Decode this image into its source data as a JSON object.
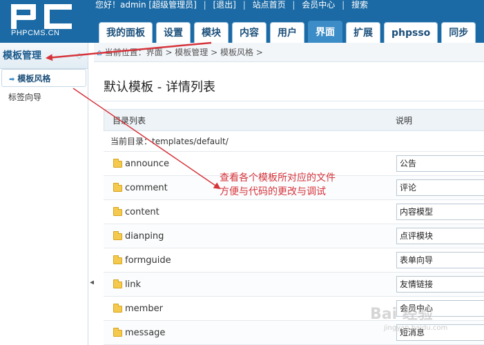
{
  "header": {
    "logo_text": "PHPCMS.CN",
    "topbar": {
      "greeting": "您好！admin [超级管理员]",
      "logout": "[退出]",
      "site_home": "站点首页",
      "member_center": "会员中心",
      "search": "搜索"
    },
    "nav": [
      {
        "label": "我的面板",
        "active": false
      },
      {
        "label": "设置",
        "active": false
      },
      {
        "label": "模块",
        "active": false
      },
      {
        "label": "内容",
        "active": false
      },
      {
        "label": "用户",
        "active": false
      },
      {
        "label": "界面",
        "active": true
      },
      {
        "label": "扩展",
        "active": false
      },
      {
        "label": "phpsso",
        "active": false
      },
      {
        "label": "同步",
        "active": false
      }
    ]
  },
  "sidebar": {
    "title": "模板管理",
    "items": [
      {
        "label": "模板风格",
        "current": true
      },
      {
        "label": "标签向导",
        "current": false
      }
    ]
  },
  "breadcrumb": "当前位置：界面 > 模板管理 > 模板风格 >",
  "page": {
    "title": "默认模板 - 详情列表",
    "columns": {
      "dir": "目录列表",
      "desc": "说明"
    },
    "current_dir": "当前目录：templates/default/",
    "rows": [
      {
        "name": "announce",
        "desc": "公告"
      },
      {
        "name": "comment",
        "desc": "评论"
      },
      {
        "name": "content",
        "desc": "内容模型"
      },
      {
        "name": "dianping",
        "desc": "点评模块"
      },
      {
        "name": "formguide",
        "desc": "表单向导"
      },
      {
        "name": "link",
        "desc": "友情链接"
      },
      {
        "name": "member",
        "desc": "会员中心"
      },
      {
        "name": "message",
        "desc": "短消息"
      }
    ]
  },
  "annotation": {
    "line1": "查看各个模板所对应的文件",
    "line2": "方便与代码的更改与调试",
    "color": "#d6333a"
  },
  "watermark": {
    "main": "Bai 经验",
    "sub": "jingyan.baidu.com"
  },
  "colors": {
    "header": "#1b6aa5",
    "active_tab": "#3b8cc7",
    "accent": "#1b4f7a"
  }
}
